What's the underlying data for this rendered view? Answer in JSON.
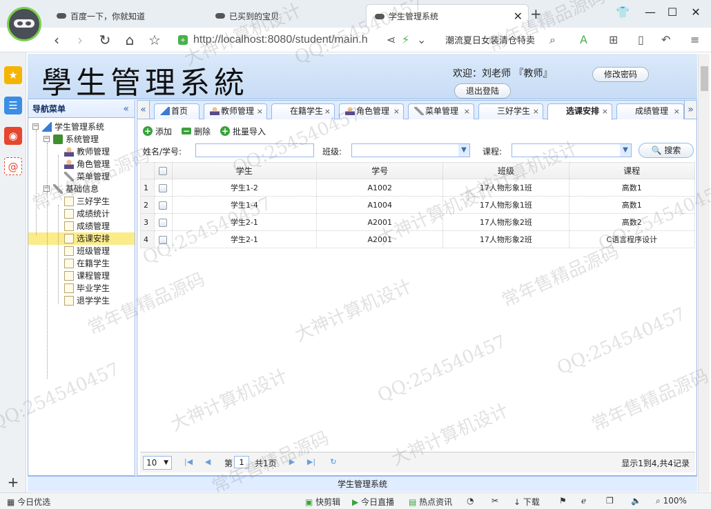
{
  "browser": {
    "tabs": [
      {
        "title": "百度一下，你就知道",
        "active": false
      },
      {
        "title": "已买到的宝贝",
        "active": false
      },
      {
        "title": "学生管理系统",
        "active": true
      }
    ],
    "url": "http://localhost:8080/student/main.h",
    "search_suggestion": "潮流夏日女装清仓特卖",
    "status_bar": {
      "left": "今日优选",
      "items": [
        "快剪辑",
        "今日直播",
        "热点资讯",
        "下载"
      ],
      "zoom": "100%"
    }
  },
  "app": {
    "title": "學生管理系統",
    "welcome": "欢迎：刘老师 『教师』",
    "change_password": "修改密码",
    "logout": "退出登陆",
    "nav": {
      "title": "导航菜单",
      "tree": [
        {
          "label": "学生管理系统",
          "level": 0,
          "icon": "home",
          "exp": "−"
        },
        {
          "label": "系统管理",
          "level": 1,
          "icon": "folder",
          "exp": "−"
        },
        {
          "label": "教师管理",
          "level": 2,
          "icon": "user"
        },
        {
          "label": "角色管理",
          "level": 2,
          "icon": "user"
        },
        {
          "label": "菜单管理",
          "level": 2,
          "icon": "tools"
        },
        {
          "label": "基础信息",
          "level": 1,
          "icon": "tools",
          "exp": "−"
        },
        {
          "label": "三好学生",
          "level": 2,
          "icon": "file"
        },
        {
          "label": "成绩统计",
          "level": 2,
          "icon": "file"
        },
        {
          "label": "成绩管理",
          "level": 2,
          "icon": "file"
        },
        {
          "label": "选课安排",
          "level": 2,
          "icon": "file",
          "selected": true
        },
        {
          "label": "班级管理",
          "level": 2,
          "icon": "file"
        },
        {
          "label": "在籍学生",
          "level": 2,
          "icon": "file"
        },
        {
          "label": "课程管理",
          "level": 2,
          "icon": "file"
        },
        {
          "label": "毕业学生",
          "level": 2,
          "icon": "file"
        },
        {
          "label": "退学学生",
          "level": 2,
          "icon": "file"
        }
      ]
    },
    "tabs": [
      {
        "label": "首页",
        "closable": false
      },
      {
        "label": "教师管理",
        "closable": true
      },
      {
        "label": "在籍学生",
        "closable": true
      },
      {
        "label": "角色管理",
        "closable": true
      },
      {
        "label": "菜单管理",
        "closable": true
      },
      {
        "label": "三好学生",
        "closable": true
      },
      {
        "label": "选课安排",
        "closable": true,
        "active": true
      },
      {
        "label": "成绩管理",
        "closable": true
      }
    ],
    "toolbar": {
      "add": "添加",
      "delete": "删除",
      "import": "批量导入"
    },
    "search": {
      "name_label": "姓名/学号:",
      "class_label": "班级:",
      "course_label": "课程:",
      "button": "搜索"
    },
    "grid": {
      "columns": [
        "学生",
        "学号",
        "班级",
        "课程"
      ],
      "rows": [
        {
          "n": "1",
          "student": "学生1-2",
          "id": "A1002",
          "class": "17人物形象1班",
          "course": "高数1"
        },
        {
          "n": "2",
          "student": "学生1-4",
          "id": "A1004",
          "class": "17人物形象1班",
          "course": "高数1"
        },
        {
          "n": "3",
          "student": "学生2-1",
          "id": "A2001",
          "class": "17人物形象2班",
          "course": "高数2"
        },
        {
          "n": "4",
          "student": "学生2-1",
          "id": "A2001",
          "class": "17人物形象2班",
          "course": "C语言程序设计"
        }
      ]
    },
    "pager": {
      "page_size": "10",
      "page_prefix": "第",
      "page": "1",
      "total_pages": "共1页",
      "summary": "显示1到4,共4记录"
    },
    "footer": "学生管理系统"
  },
  "watermarks": [
    "QQ:254540457",
    "大神计算机设计",
    "常年售精品源码"
  ],
  "colors": {
    "panel_border": "#95b8e7",
    "panel_header": "#e0ecff",
    "selected": "#fbec88"
  }
}
